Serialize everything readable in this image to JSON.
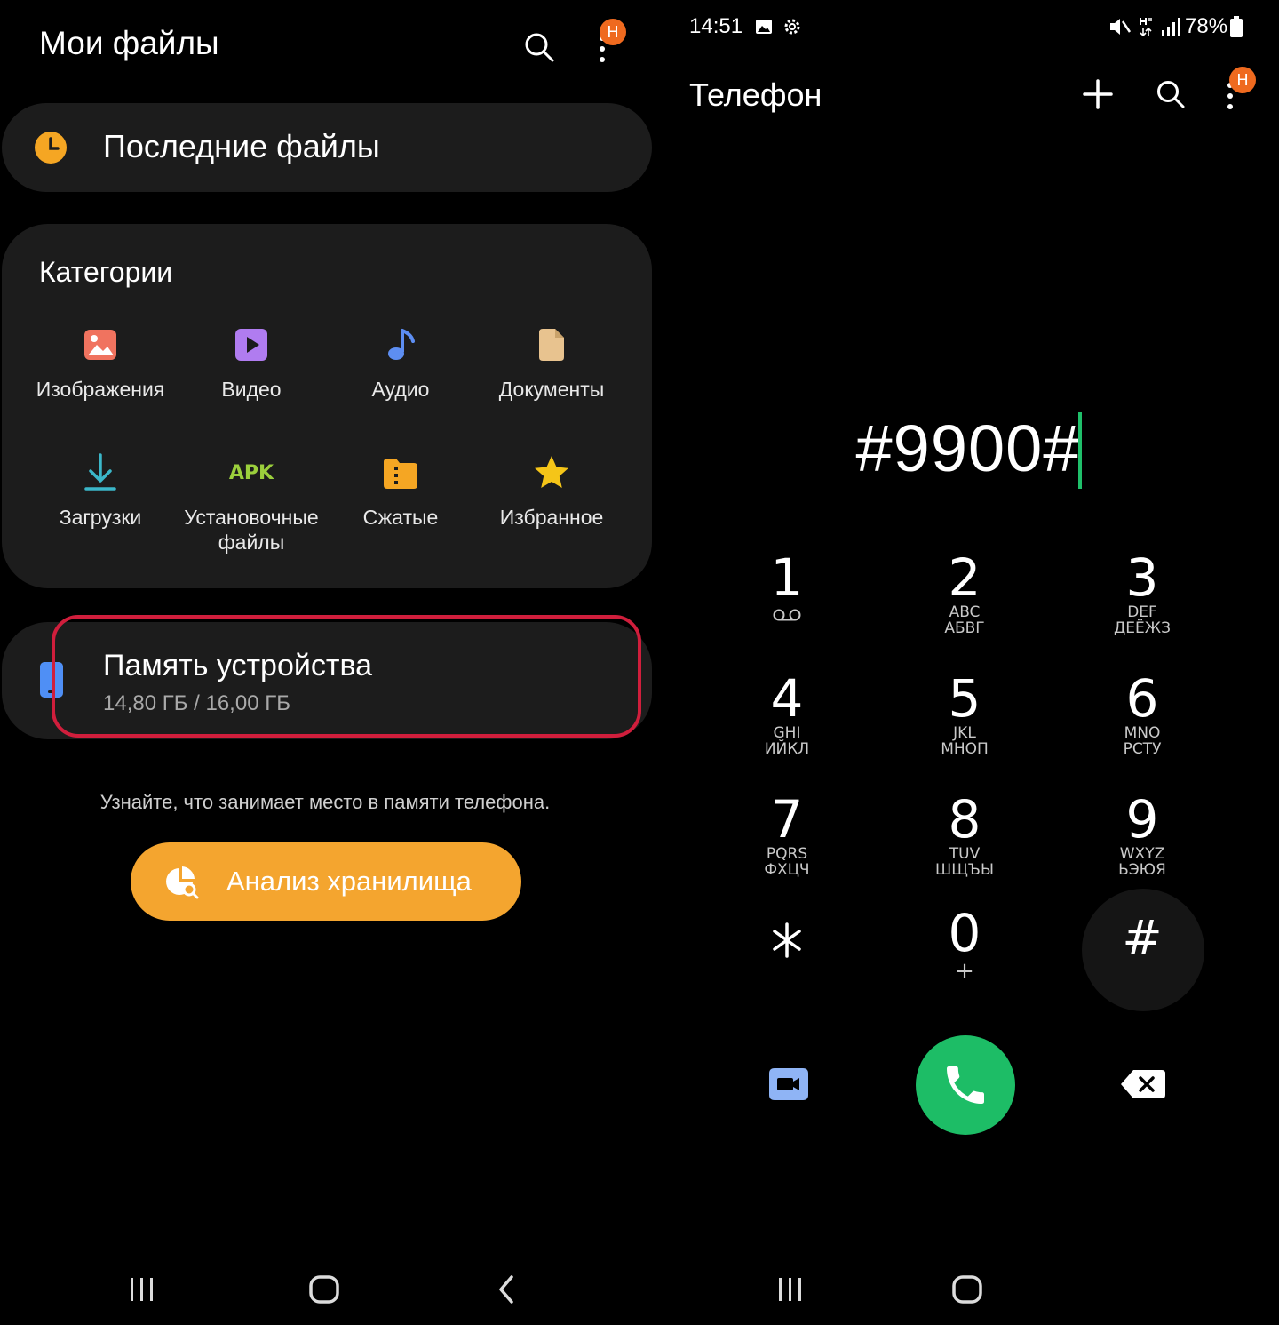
{
  "files_app": {
    "title": "Мои файлы",
    "badge": "Н",
    "recent": {
      "label": "Последние файлы"
    },
    "categories": {
      "heading": "Категории",
      "items": [
        {
          "label": "Изображения",
          "icon": "image-icon",
          "color": "#f0735f"
        },
        {
          "label": "Видео",
          "icon": "video-icon",
          "color": "#b07cf0"
        },
        {
          "label": "Аудио",
          "icon": "audio-icon",
          "color": "#5d8ef2"
        },
        {
          "label": "Документы",
          "icon": "document-icon",
          "color": "#e8c38f"
        },
        {
          "label": "Загрузки",
          "icon": "download-icon",
          "color": "#3bb7c9"
        },
        {
          "label": "Установочные файлы",
          "label_line1": "Установочные",
          "label_line2": "файлы",
          "icon": "apk-icon",
          "icon_text": "APK",
          "color": "#9bcf3c"
        },
        {
          "label": "Сжатые",
          "icon": "archive-icon",
          "color": "#f5a623"
        },
        {
          "label": "Избранное",
          "icon": "star-icon",
          "color": "#f5c518"
        }
      ]
    },
    "storage": {
      "title": "Память устройства",
      "usage": "14,80 ГБ / 16,00 ГБ",
      "icon": "phone-storage-icon"
    },
    "hint": "Узнайте, что занимает место в памяти телефона.",
    "analyze_button": "Анализ хранилища"
  },
  "phone_app": {
    "status_bar": {
      "time": "14:51",
      "battery": "78%"
    },
    "title": "Телефон",
    "badge": "Н",
    "dialed_number": "#9900#",
    "keys": [
      {
        "digit": "1",
        "letters1": "",
        "letters2": ""
      },
      {
        "digit": "2",
        "letters1": "ABC",
        "letters2": "АБВГ"
      },
      {
        "digit": "3",
        "letters1": "DEF",
        "letters2": "ДЕЁЖЗ"
      },
      {
        "digit": "4",
        "letters1": "GHI",
        "letters2": "ИЙКЛ"
      },
      {
        "digit": "5",
        "letters1": "JKL",
        "letters2": "МНОП"
      },
      {
        "digit": "6",
        "letters1": "MNO",
        "letters2": "РСТУ"
      },
      {
        "digit": "7",
        "letters1": "PQRS",
        "letters2": "ФХЦЧ"
      },
      {
        "digit": "8",
        "letters1": "TUV",
        "letters2": "ШЩЪЫ"
      },
      {
        "digit": "9",
        "letters1": "WXYZ",
        "letters2": "ЬЭЮЯ"
      },
      {
        "digit": "⁎",
        "letters1": "",
        "letters2": ""
      },
      {
        "digit": "0",
        "letters1": "+",
        "letters2": ""
      },
      {
        "digit": "#",
        "letters1": "",
        "letters2": ""
      }
    ],
    "colors": {
      "call": "#1dbd66",
      "cursor": "#1fbf6a",
      "video_call": "#8fb4f5"
    }
  },
  "accent": {
    "highlight_border": "#d01e3c",
    "analyze_button": "#f4a52f"
  }
}
